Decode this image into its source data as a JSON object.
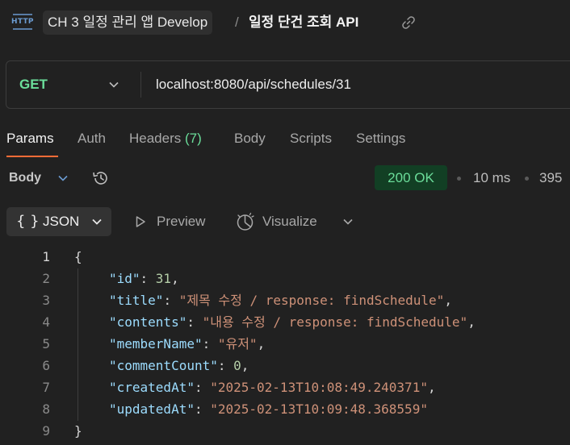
{
  "header": {
    "icon_label": "HTTP",
    "collection": "CH 3 일정 관리 앱 Develop",
    "separator": "/",
    "request_name": "일정 단건 조회 API"
  },
  "url_bar": {
    "method": "GET",
    "url": "localhost:8080/api/schedules/31"
  },
  "request_tabs": [
    {
      "label": "Params",
      "count": ""
    },
    {
      "label": "Auth",
      "count": ""
    },
    {
      "label": "Headers",
      "count": "(7)"
    },
    {
      "label": "Body",
      "count": ""
    },
    {
      "label": "Scripts",
      "count": ""
    },
    {
      "label": "Settings",
      "count": ""
    }
  ],
  "response": {
    "section_label": "Body",
    "status": "200 OK",
    "time": "10 ms",
    "size": "395"
  },
  "view_toolbar": {
    "format_brace": "{ }",
    "format": "JSON",
    "preview": "Preview",
    "visualize": "Visualize"
  },
  "code": {
    "line_numbers": [
      "1",
      "2",
      "3",
      "4",
      "5",
      "6",
      "7",
      "8",
      "9"
    ],
    "open_brace": "{",
    "close_brace": "}",
    "fields": [
      {
        "key": "\"id\"",
        "value": "31",
        "kind": "number",
        "comma": ","
      },
      {
        "key": "\"title\"",
        "value": "\"제목 수정 / response: findSchedule\"",
        "kind": "string",
        "comma": ","
      },
      {
        "key": "\"contents\"",
        "value": "\"내용 수정 / response: findSchedule\"",
        "kind": "string",
        "comma": ","
      },
      {
        "key": "\"memberName\"",
        "value": "\"유저\"",
        "kind": "string",
        "comma": ","
      },
      {
        "key": "\"commentCount\"",
        "value": "0",
        "kind": "number",
        "comma": ","
      },
      {
        "key": "\"createdAt\"",
        "value": "\"2025-02-13T10:08:49.240371\"",
        "kind": "string",
        "comma": ","
      },
      {
        "key": "\"updatedAt\"",
        "value": "\"2025-02-13T10:09:48.368559\"",
        "kind": "string",
        "comma": ""
      }
    ]
  },
  "colors": {
    "background": "#212121",
    "method_get": "#6bdd9a",
    "accent_tab": "#ff6c37",
    "status_ok_bg": "#123f24",
    "status_ok_text": "#6bdd9a",
    "json_key": "#9cdcfe",
    "json_string": "#ce9178",
    "json_number": "#b5cea8"
  },
  "icons": {
    "request_type": "http-icon",
    "copy_link": "link-icon",
    "method_dropdown": "chevron-down-icon",
    "history": "history-icon",
    "preview": "play-icon",
    "visualize": "visualize-icon"
  }
}
